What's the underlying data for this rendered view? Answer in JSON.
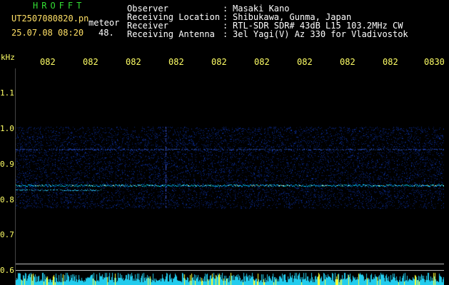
{
  "header": {
    "brand": "HROFFT",
    "filename": "UT2507080820.pn",
    "meteor": "meteor",
    "datetime": "25.07.08 08:20",
    "count": "48.",
    "rows": [
      {
        "label": "Observer",
        "value": "Masaki Kano"
      },
      {
        "label": "Receiving Location",
        "value": "Shibukawa, Gunma, Japan"
      },
      {
        "label": "Receiver",
        "value": "RTL-SDR SDR# 43dB L15 103.2MHz CW"
      },
      {
        "label": "Receiving Antenna",
        "value": "3el Yagi(V) Az 330 for Vladivostok"
      }
    ],
    "colon": ":"
  },
  "axis": {
    "y_unit": "kHz",
    "y_ticks": [
      "1.1",
      "1.0",
      "0.9",
      "0.8",
      "0.7",
      "0.6"
    ],
    "x_ticks": [
      "082",
      "082",
      "082",
      "082",
      "082",
      "082",
      "082",
      "082",
      "082",
      "0830"
    ]
  },
  "colors": {
    "tick_text": "#ffff66",
    "header_green": "#33dd33",
    "signal": "#00ffff",
    "noise": "#0a1a8a"
  }
}
